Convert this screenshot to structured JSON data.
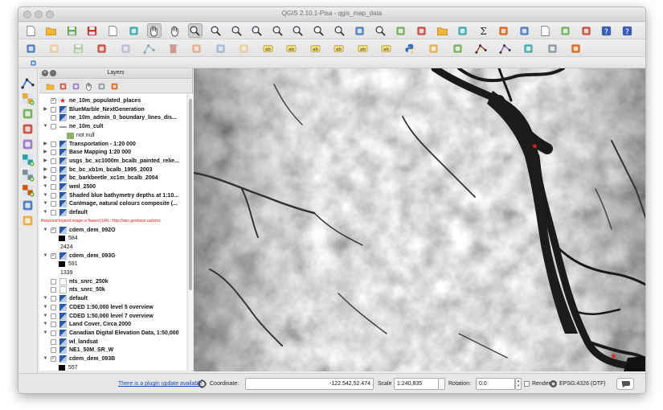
{
  "window": {
    "title": "QGIS 2.10.1-Pisa - qgis_map_data"
  },
  "toolbar1": {
    "icons": [
      "new-project-icon",
      "open-project-icon",
      "save-project-icon",
      "save-as-icon",
      "new-print-composer-icon",
      "composer-manager-icon",
      "pan-icon",
      "pan-to-selection-icon",
      "touch-zoom-icon",
      "zoom-in-icon",
      "zoom-out-icon",
      "zoom-full-icon",
      "zoom-to-layer-icon",
      "zoom-to-selection-icon",
      "zoom-last-icon",
      "zoom-next-icon",
      "refresh-icon",
      "identify-icon",
      "select-icon",
      "deselect-icon",
      "open-attribute-table-icon",
      "field-calculator-icon",
      "statistics-icon",
      "measure-icon",
      "map-tips-icon",
      "new-bookmark-icon",
      "show-bookmarks-icon",
      "text-annotation-icon",
      "help-icon",
      "whats-this-icon"
    ]
  },
  "toolbar2": {
    "icons": [
      "current-edits-icon",
      "toggle-editing-icon",
      "save-edits-icon",
      "add-feature-icon",
      "move-feature-icon",
      "node-tool-icon",
      "delete-selected-icon",
      "cut-features-icon",
      "copy-features-icon",
      "paste-features-icon",
      "label-tool-icon",
      "pin-label-icon",
      "show-hide-labels-icon",
      "move-label-icon",
      "rotate-label-icon",
      "change-label-icon",
      "python-console-icon",
      "grass-tools-icon",
      "georeferencer-icon",
      "digitize-icon",
      "advanced-digitize-icon",
      "coordinate-capture-icon",
      "gps-icon",
      "osm-icon"
    ]
  },
  "toolbar3": {
    "icons": [
      "plugin-icon"
    ]
  },
  "leftbar": {
    "icons": [
      "add-vector-layer-icon",
      "add-raster-layer-icon",
      "add-postgis-layer-icon",
      "add-spatialite-layer-icon",
      "add-mssql-layer-icon",
      "add-wms-layer-icon",
      "add-wcs-layer-icon",
      "add-wfs-layer-icon",
      "add-delimited-text-icon",
      "add-virtual-layer-icon"
    ]
  },
  "layers_panel": {
    "title": "Layers",
    "rows": [
      {
        "label": "ne_10m_populated_places",
        "type": "point",
        "checked": true,
        "expand": "",
        "indent": 0
      },
      {
        "label": "BlueMarble_NextGeneration",
        "type": "raster",
        "checked": false,
        "expand": "▶",
        "indent": 0
      },
      {
        "label": "ne_10m_admin_0_boundary_lines_dis...",
        "type": "raster",
        "checked": false,
        "expand": "",
        "indent": 0
      },
      {
        "label": "ne_10m_cult",
        "type": "line",
        "checked": false,
        "expand": "▼",
        "indent": 0
      },
      {
        "label": "not null",
        "type": "legend-green",
        "checked": null,
        "expand": "",
        "indent": 1
      },
      {
        "label": "Transportation - 1:20 000",
        "type": "raster",
        "checked": false,
        "expand": "▶",
        "indent": 0
      },
      {
        "label": "Base Mapping 1:20 000",
        "type": "raster",
        "checked": false,
        "expand": "▶",
        "indent": 0
      },
      {
        "label": "usgs_bc_xc1000m_bcalb_painted_relie...",
        "type": "raster",
        "checked": false,
        "expand": "▶",
        "indent": 0
      },
      {
        "label": "bc_bc_xb1m_bcalb_1995_2003",
        "type": "raster",
        "checked": false,
        "expand": "▶",
        "indent": 0
      },
      {
        "label": "bc_barkbeetle_xc1m_bcalb_2004",
        "type": "raster",
        "checked": false,
        "expand": "▶",
        "indent": 0
      },
      {
        "label": "wml_2500",
        "type": "raster",
        "checked": false,
        "expand": "▼",
        "indent": 0
      },
      {
        "label": "Shaded blue bathymetry depths at 1:10...",
        "type": "raster",
        "checked": false,
        "expand": "▼",
        "indent": 0
      },
      {
        "label": "CanImage, natural colours composite (...",
        "type": "raster",
        "checked": false,
        "expand": "▼",
        "indent": 0
      },
      {
        "label": "default",
        "type": "raster",
        "checked": false,
        "expand": "▼",
        "indent": 0
      },
      {
        "label": "Returned legend image is flawed [URL: http://ows.geobase.ca/wms",
        "type": "warning",
        "checked": null,
        "expand": "",
        "indent": 0
      },
      {
        "label": "cdem_dem_092O",
        "type": "raster",
        "checked": true,
        "expand": "▼",
        "indent": 0
      },
      {
        "label": "584",
        "type": "legend-black",
        "checked": null,
        "expand": "",
        "indent": 1
      },
      {
        "label": "2424",
        "type": "legend-text",
        "checked": null,
        "expand": "",
        "indent": 1
      },
      {
        "label": "cdem_dem_093G",
        "type": "raster",
        "checked": true,
        "expand": "▼",
        "indent": 0
      },
      {
        "label": "591",
        "type": "legend-black",
        "checked": null,
        "expand": "",
        "indent": 1
      },
      {
        "label": "1339",
        "type": "legend-text",
        "checked": null,
        "expand": "",
        "indent": 1
      },
      {
        "label": "nts_snrc_250k",
        "type": "blank",
        "checked": false,
        "expand": "",
        "indent": 0
      },
      {
        "label": "nts_snrc_50k",
        "type": "blank",
        "checked": false,
        "expand": "",
        "indent": 0
      },
      {
        "label": "default",
        "type": "raster",
        "checked": false,
        "expand": "▼",
        "indent": 0
      },
      {
        "label": "CDED 1:50,000 level 5 overview",
        "type": "raster",
        "checked": false,
        "expand": "▼",
        "indent": 0
      },
      {
        "label": "CDED 1:50,000 level 7 overview",
        "type": "raster",
        "checked": false,
        "expand": "▼",
        "indent": 0
      },
      {
        "label": "Land Cover, Circa 2000",
        "type": "raster",
        "checked": false,
        "expand": "▼",
        "indent": 0
      },
      {
        "label": "Canadian Digital Elevation Data, 1:50,000",
        "type": "raster",
        "checked": false,
        "expand": "▼",
        "indent": 0
      },
      {
        "label": "wl_landsat",
        "type": "raster",
        "checked": false,
        "expand": "",
        "indent": 0
      },
      {
        "label": "NE1_50M_SR_W",
        "type": "raster",
        "checked": false,
        "expand": "",
        "indent": 0
      },
      {
        "label": "cdem_dem_093B",
        "type": "raster",
        "checked": true,
        "expand": "▼",
        "indent": 0
      },
      {
        "label": "557",
        "type": "legend-black",
        "checked": null,
        "expand": "",
        "indent": 1
      }
    ]
  },
  "statusbar": {
    "plugin_update": "There is a plugin update available",
    "coordinate_label": "Coordinate:",
    "coordinate_value": "-122.542,52.474",
    "scale_label": "Scale",
    "scale_value": "1:240,835",
    "rotation_label": "Rotation:",
    "rotation_value": "0.0",
    "render_label": "Render",
    "crs_label": "EPSG:4326 (OTF)",
    "render_checked": false
  },
  "colors": {
    "point_marker": "#e2231a",
    "link": "#1a47c4",
    "legend_green": "#8faf6a"
  }
}
